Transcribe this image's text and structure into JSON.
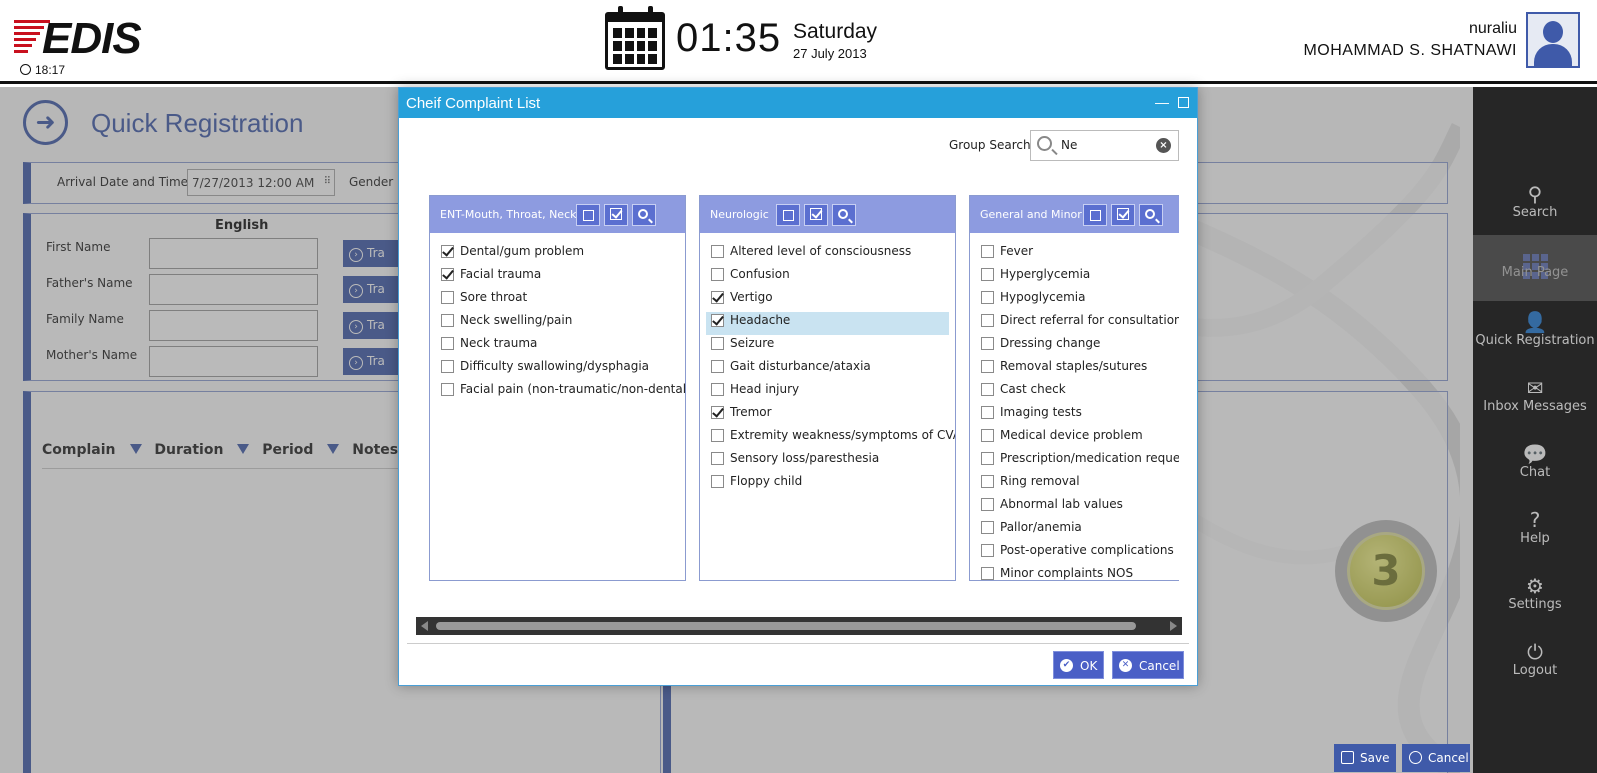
{
  "header": {
    "logo_text": "EDIS",
    "small_clock": "18:17",
    "time": "01:35",
    "day": "Saturday",
    "date": "27 July 2013",
    "username": "nuraliu",
    "full_name": "MOHAMMAD S.  SHATNAWI"
  },
  "page": {
    "title": "Quick Registration",
    "arrival_label": "Arrival Date and Time",
    "arrival_value": "7/27/2013 12:00 AM",
    "gender_label": "Gender",
    "english_label": "English",
    "name_fields": [
      {
        "label": "First Name"
      },
      {
        "label": "Father's Name"
      },
      {
        "label": "Family Name"
      },
      {
        "label": "Mother's Name"
      }
    ],
    "translate_label": "Tra",
    "complain_columns": [
      "Complain",
      "Duration",
      "Period",
      "Notes"
    ],
    "triage_level": "3",
    "save_label": "Save",
    "cancel_label": "Cancel"
  },
  "sidebar": {
    "items": [
      {
        "label": "Search",
        "icon": "search-icon"
      },
      {
        "label": "Main Page",
        "icon": "grid-icon",
        "active": true
      },
      {
        "label": "Quick Registration",
        "icon": "add-user-icon"
      },
      {
        "label": "Inbox Messages",
        "icon": "envelope-icon"
      },
      {
        "label": "Chat",
        "icon": "chat-icon"
      },
      {
        "label": "Help",
        "icon": "help-icon"
      },
      {
        "label": "Settings",
        "icon": "gear-icon"
      },
      {
        "label": "Logout",
        "icon": "power-icon"
      }
    ]
  },
  "dialog": {
    "title": "Cheif Complaint List",
    "group_search_label": "Group Search",
    "group_search_value": "Ne",
    "ok_label": "OK",
    "cancel_label": "Cancel",
    "columns": [
      {
        "title": "ENT-Mouth, Throat, Neck",
        "items": [
          {
            "label": "Dental/gum problem",
            "checked": true
          },
          {
            "label": "Facial trauma",
            "checked": true
          },
          {
            "label": "Sore throat",
            "checked": false
          },
          {
            "label": "Neck swelling/pain",
            "checked": false
          },
          {
            "label": "Neck trauma",
            "checked": false
          },
          {
            "label": "Difficulty swallowing/dysphagia",
            "checked": false
          },
          {
            "label": "Facial pain (non-traumatic/non-dental)",
            "checked": false
          }
        ]
      },
      {
        "title": "Neurologic",
        "items": [
          {
            "label": "Altered level of consciousness",
            "checked": false
          },
          {
            "label": "Confusion",
            "checked": false
          },
          {
            "label": "Vertigo",
            "checked": true
          },
          {
            "label": "Headache",
            "checked": true,
            "selected": true
          },
          {
            "label": "Seizure",
            "checked": false
          },
          {
            "label": "Gait disturbance/ataxia",
            "checked": false
          },
          {
            "label": "Head injury",
            "checked": false
          },
          {
            "label": "Tremor",
            "checked": true
          },
          {
            "label": "Extremity weakness/symptoms of CVA",
            "checked": false
          },
          {
            "label": "Sensory loss/paresthesia",
            "checked": false
          },
          {
            "label": "Floppy child",
            "checked": false
          }
        ]
      },
      {
        "title": "General and Minor",
        "items": [
          {
            "label": "Fever",
            "checked": false
          },
          {
            "label": "Hyperglycemia",
            "checked": false
          },
          {
            "label": "Hypoglycemia",
            "checked": false
          },
          {
            "label": "Direct referral for consultation",
            "checked": false
          },
          {
            "label": "Dressing change",
            "checked": false
          },
          {
            "label": "Removal staples/sutures",
            "checked": false
          },
          {
            "label": "Cast check",
            "checked": false
          },
          {
            "label": "Imaging tests",
            "checked": false
          },
          {
            "label": "Medical device problem",
            "checked": false
          },
          {
            "label": "Prescription/medication request",
            "checked": false
          },
          {
            "label": "Ring removal",
            "checked": false
          },
          {
            "label": "Abnormal lab values",
            "checked": false
          },
          {
            "label": "Pallor/anemia",
            "checked": false
          },
          {
            "label": "Post-operative complications",
            "checked": false
          },
          {
            "label": "Minor complaints NOS",
            "checked": false
          }
        ]
      }
    ]
  },
  "colors": {
    "brand_red": "#c8101e",
    "accent_blue": "#3f5aa9",
    "titlebar_blue": "#26a0da",
    "column_header": "#8d9be0",
    "selected_row": "#c9e3f1"
  }
}
